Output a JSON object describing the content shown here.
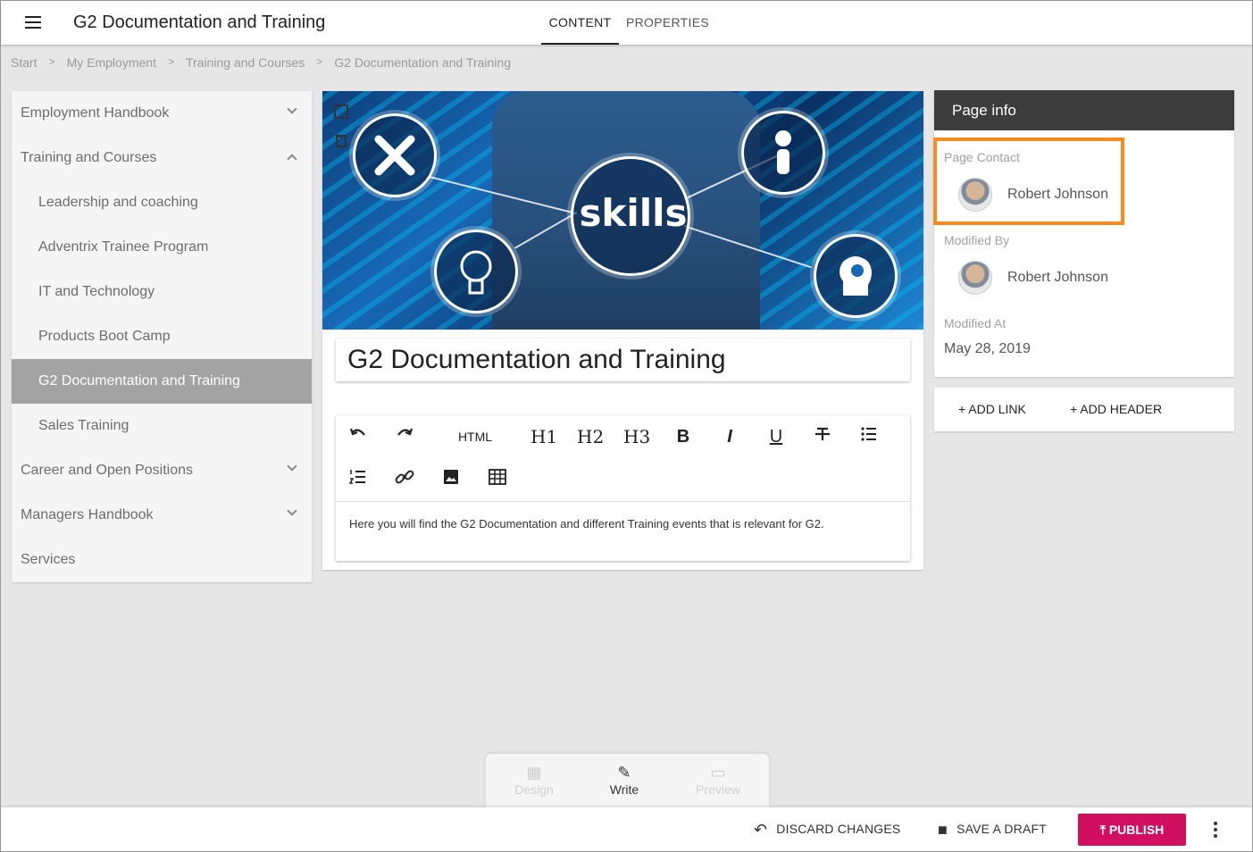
{
  "header": {
    "title": "G2 Documentation and Training",
    "tabs": [
      {
        "label": "CONTENT",
        "active": true
      },
      {
        "label": "PROPERTIES",
        "active": false
      }
    ]
  },
  "breadcrumb": [
    "Start",
    "My Employment",
    "Training and Courses",
    "G2 Documentation and Training"
  ],
  "sidebar": {
    "items": [
      {
        "label": "Employment Handbook",
        "level": 0,
        "chevron": "down"
      },
      {
        "label": "Training and Courses",
        "level": 0,
        "chevron": "up"
      },
      {
        "label": "Leadership and coaching",
        "level": 1
      },
      {
        "label": "Adventrix Trainee Program",
        "level": 1
      },
      {
        "label": "IT and Technology",
        "level": 1
      },
      {
        "label": "Products Boot Camp",
        "level": 1
      },
      {
        "label": "G2 Documentation and Training",
        "level": 1,
        "active": true
      },
      {
        "label": "Sales Training",
        "level": 1
      },
      {
        "label": "Career and Open Positions",
        "level": 0,
        "chevron": "down"
      },
      {
        "label": "Managers Handbook",
        "level": 0,
        "chevron": "down"
      },
      {
        "label": "Services",
        "level": 0
      }
    ]
  },
  "hero": {
    "word": "skills"
  },
  "page": {
    "title": "G2 Documentation and Training",
    "body": "Here you will find the G2 Documentation and different Training events that is relevant for G2."
  },
  "toolbar": {
    "html_label": "HTML",
    "h1": "H1",
    "h2": "H2",
    "h3": "H3",
    "bold": "B",
    "italic": "I",
    "underline": "U"
  },
  "page_info": {
    "heading": "Page info",
    "contact_label": "Page Contact",
    "contact_name": "Robert Johnson",
    "modified_by_label": "Modified By",
    "modified_by_name": "Robert Johnson",
    "modified_at_label": "Modified At",
    "modified_at": "May 28, 2019",
    "highlight_color": "#f68b1f"
  },
  "links": {
    "add_link": "+ ADD LINK",
    "add_header": "+ ADD HEADER"
  },
  "modes": {
    "design": "Design",
    "write": "Write",
    "preview": "Preview"
  },
  "actions": {
    "discard": "DISCARD CHANGES",
    "save_draft": "SAVE A DRAFT",
    "publish": "PUBLISH",
    "publish_color": "#d0105e"
  }
}
